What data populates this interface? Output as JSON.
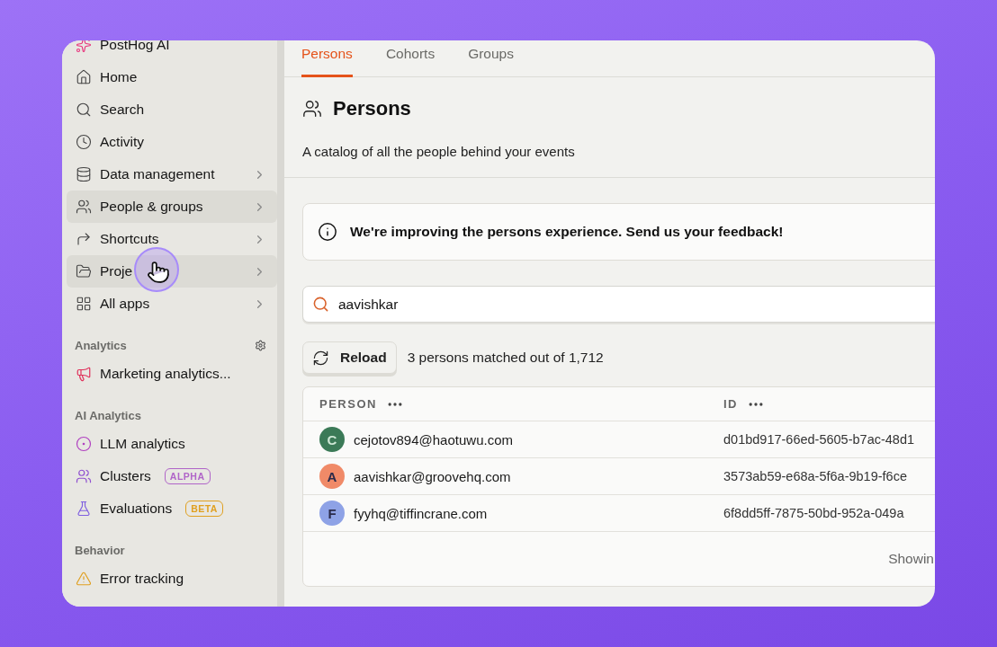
{
  "sidebar": {
    "items": [
      {
        "label": "PostHog AI",
        "chevron": false,
        "highlighted": false
      },
      {
        "label": "Home",
        "chevron": false,
        "highlighted": false
      },
      {
        "label": "Search",
        "chevron": false,
        "highlighted": false
      },
      {
        "label": "Activity",
        "chevron": false,
        "highlighted": false
      },
      {
        "label": "Data management",
        "chevron": true,
        "highlighted": false
      },
      {
        "label": "People & groups",
        "chevron": true,
        "highlighted": true
      },
      {
        "label": "Shortcuts",
        "chevron": true,
        "highlighted": false
      },
      {
        "label": "Proje",
        "chevron": true,
        "highlighted": true
      },
      {
        "label": "All apps",
        "chevron": true,
        "highlighted": false
      }
    ],
    "sections": [
      {
        "title": "Analytics",
        "settings": true,
        "items": [
          {
            "label": "Marketing analytics..."
          }
        ]
      },
      {
        "title": "AI Analytics",
        "settings": false,
        "items": [
          {
            "label": "LLM analytics"
          },
          {
            "label": "Clusters",
            "badge": {
              "text": "ALPHA",
              "color": "#b064c8"
            }
          },
          {
            "label": "Evaluations",
            "badge": {
              "text": "BETA",
              "color": "#e0a020"
            }
          }
        ]
      },
      {
        "title": "Behavior",
        "settings": false,
        "items": [
          {
            "label": "Error tracking"
          }
        ]
      }
    ]
  },
  "tabs": [
    {
      "label": "Persons",
      "selected": true
    },
    {
      "label": "Cohorts",
      "selected": false
    },
    {
      "label": "Groups",
      "selected": false
    }
  ],
  "page": {
    "title": "Persons",
    "subtitle": "A catalog of all the people behind your events"
  },
  "banner": "We're improving the persons experience. Send us your feedback!",
  "search": {
    "value": "aavishkar"
  },
  "reload": "Reload",
  "match_count": "3 persons matched out of 1,712",
  "table": {
    "columns": [
      "PERSON",
      "ID"
    ],
    "rows": [
      {
        "initial": "C",
        "color": "#3b7a57",
        "email": "cejotov894@haotuwu.com",
        "id": "d01bd917-66ed-5605-b7ac-48d1"
      },
      {
        "initial": "A",
        "color": "#f08a68",
        "email": "aavishkar@groovehq.com",
        "id": "3573ab59-e68a-5f6a-9b19-f6ce"
      },
      {
        "initial": "F",
        "color": "#8ea2e6",
        "email": "fyyhq@tiffincrane.com",
        "id": "6f8dd5ff-7875-50bd-952a-049a"
      }
    ],
    "footer": "Showin"
  }
}
